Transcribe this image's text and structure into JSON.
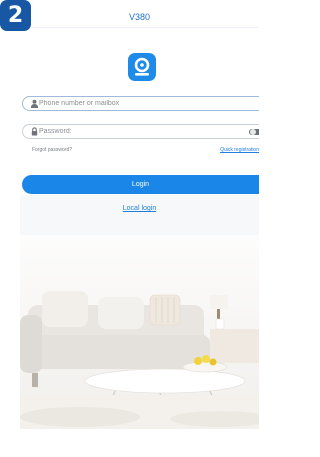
{
  "step_number": "2",
  "app": {
    "title": "V380"
  },
  "login_form": {
    "phone_placeholder": "Phone number or mailbox",
    "password_placeholder": "Password:",
    "forgot_password": "Forgot password?",
    "quick_registration": "Quick registration",
    "login_label": "Login",
    "local_login_label": "Local login"
  },
  "colors": {
    "accent": "#1a86e8",
    "badge": "#1757a3"
  },
  "icons": {
    "logo": "camera-logo-icon",
    "user": "user-icon",
    "lock": "lock-icon",
    "toggle": "password-visibility-toggle"
  }
}
